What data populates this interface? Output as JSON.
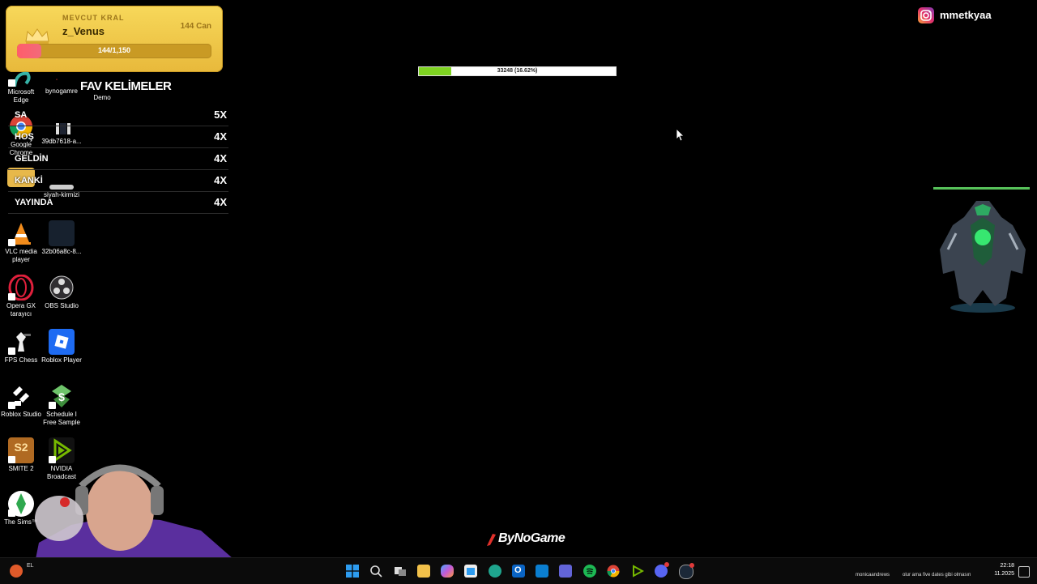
{
  "king": {
    "label": "MEVCUT KRAL",
    "name": "z_Venus",
    "hp_label": "144 Can",
    "bar_text": "144/1,150",
    "bar_fraction": 0.125
  },
  "desktop": {
    "icons": [
      {
        "label": "Microsoft Edge"
      },
      {
        "label": "bynogamre"
      },
      {
        "label": "Demo"
      },
      {
        "label": "Google Chrome"
      },
      {
        "label": "39db7618-a..."
      },
      {
        "label": "siyah-kirmizi"
      },
      {
        "label": "VLC media player"
      },
      {
        "label": "32b06a8c-8..."
      },
      {
        "label": "Opera GX tarayıcı"
      },
      {
        "label": "OBS Studio"
      },
      {
        "label": "FPS Chess"
      },
      {
        "label": "Roblox Player"
      },
      {
        "label": "Roblox Studio"
      },
      {
        "label": "Schedule I Free Sample"
      },
      {
        "label": "SMITE 2"
      },
      {
        "label": "NVIDIA Broadcast"
      },
      {
        "label": "The Sims™"
      }
    ]
  },
  "fav": {
    "title": "FAV KELİMELER",
    "rows": [
      {
        "word": "SA",
        "count": "5X"
      },
      {
        "word": "HOŞ",
        "count": "4X"
      },
      {
        "word": "GELDİN",
        "count": "4X"
      },
      {
        "word": "KANKİ",
        "count": "4X"
      },
      {
        "word": "YAYINDA",
        "count": "4X"
      }
    ]
  },
  "progress": {
    "text": "33248 (16.62%)",
    "fraction": 0.1662,
    "fill_color": "#7ed321"
  },
  "instagram": {
    "handle": "mmetkyaa",
    "icon": "instagram-icon"
  },
  "branding": {
    "logo_text": "ByNoGame",
    "accent": "#e0302a"
  },
  "taskbar": {
    "items": [
      "windows-start-icon",
      "search-icon",
      "task-view-icon",
      "file-explorer-icon",
      "copilot-icon",
      "store-icon",
      "edge-icon",
      "outlook-icon",
      "terminal-icon",
      "teams-icon",
      "spotify-icon",
      "chrome-icon",
      "nvidia-icon",
      "discord-icon",
      "steam-icon"
    ],
    "tray_user": "monicaandrews",
    "tray_message": "olur ama five dates gibi olmasın",
    "time": "22:18",
    "date": "11.2025",
    "left_app_label": "EL"
  }
}
